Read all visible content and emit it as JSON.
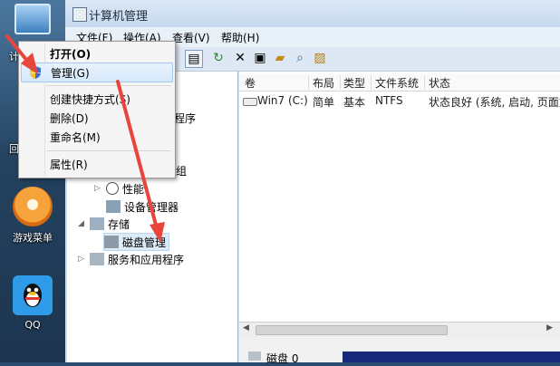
{
  "desktop": {
    "icons": [
      {
        "label": "游戏菜单",
        "icon": "game-menu-icon"
      },
      {
        "label": "QQ",
        "icon": "qq-penguin-icon"
      }
    ],
    "partial_labels": [
      "计",
      "回"
    ]
  },
  "window": {
    "title": "计算机管理",
    "menu": [
      "文件(F)",
      "操作(A)",
      "查看(V)",
      "帮助(H)"
    ]
  },
  "tree": {
    "items": [
      {
        "label": "程序"
      },
      {
        "label": "组"
      },
      {
        "label": "性能"
      },
      {
        "label": "设备管理器"
      },
      {
        "label": "存储"
      },
      {
        "label": "磁盘管理"
      },
      {
        "label": "服务和应用程序"
      }
    ]
  },
  "list": {
    "columns": [
      "卷",
      "布局",
      "类型",
      "文件系统",
      "状态"
    ],
    "rows": [
      {
        "volume": "Win7 (C:)",
        "layout": "简单",
        "type": "基本",
        "fs": "NTFS",
        "status": "状态良好 (系统, 启动, 页面文"
      }
    ],
    "bottom_label": "磁盘 0"
  },
  "context_menu": {
    "items": [
      "打开(O)",
      "管理(G)",
      "创建快捷方式(S)",
      "删除(D)",
      "重命名(M)",
      "属性(R)"
    ],
    "highlighted": "管理(G)"
  },
  "colors": {
    "annotation_arrow": "#e8453c",
    "selection": "#d6e8fb",
    "desktop": "#2a4a6e"
  }
}
